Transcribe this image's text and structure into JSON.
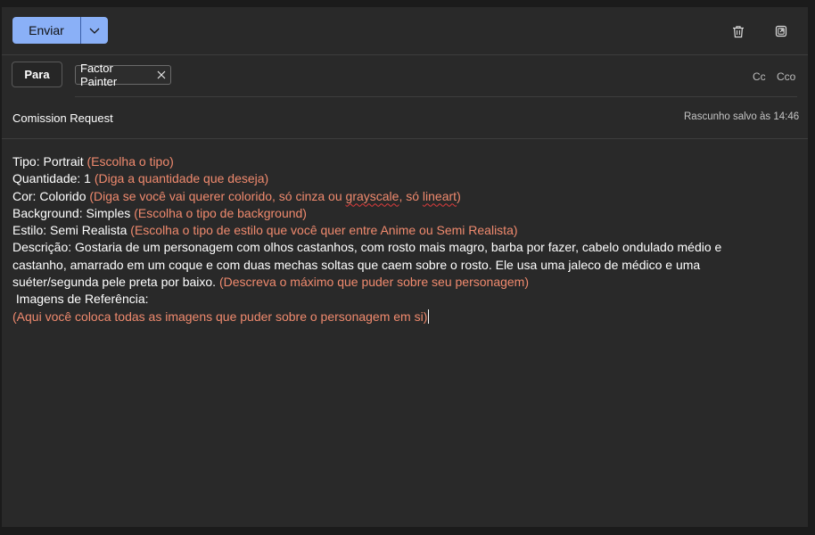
{
  "toolbar": {
    "send_label": "Enviar",
    "send_dropdown_icon": "chevron-down-icon",
    "delete_icon": "trash-icon",
    "popout_icon": "popout-icon"
  },
  "recipients": {
    "to_label": "Para",
    "chips": [
      {
        "name": "Factor Painter"
      }
    ],
    "cc_label": "Cc",
    "bcc_label": "Cco"
  },
  "subject": "Comission Request",
  "draft_status": "Rascunho salvo às 14:46",
  "body": {
    "tipo_label": "Tipo: Portrait ",
    "tipo_hint": "(Escolha o tipo)",
    "quantidade_label": "Quantidade: 1 ",
    "quantidade_hint": "(Diga a quantidade que deseja)",
    "cor_label": "Cor: Colorido ",
    "cor_hint_a": "(Diga se você vai querer colorido, só cinza ou ",
    "cor_hint_b": "grayscale",
    "cor_hint_c": ", só ",
    "cor_hint_d": "lineart",
    "cor_hint_e": ")",
    "background_label": "Background: Simples ",
    "background_hint": "(Escolha o tipo de background)",
    "estilo_label": "Estilo: Semi Realista ",
    "estilo_hint": "(Escolha o tipo de estilo que você quer entre Anime ou Semi Realista)",
    "descricao_line1": "Descrição: Gostaria de um personagem com olhos castanhos, com rosto mais magro, barba por fazer, cabelo ondulado médio e",
    "descricao_line2": "castanho, amarrado em um coque e com duas mechas soltas que caem sobre o rosto. Ele usa uma jaleco de médico e uma",
    "descricao_line3": "suéter/segunda pele preta por baixo. ",
    "descricao_hint": "(Descreva o máximo que puder sobre seu personagem)",
    "imagens_label": " Imagens de Referência:",
    "imagens_hint": "(Aqui você coloca todas as imagens que puder sobre o personagem em si)"
  },
  "colors": {
    "accent": "#8ab0f7",
    "hint_text": "#f08a6e",
    "background": "#292929"
  }
}
